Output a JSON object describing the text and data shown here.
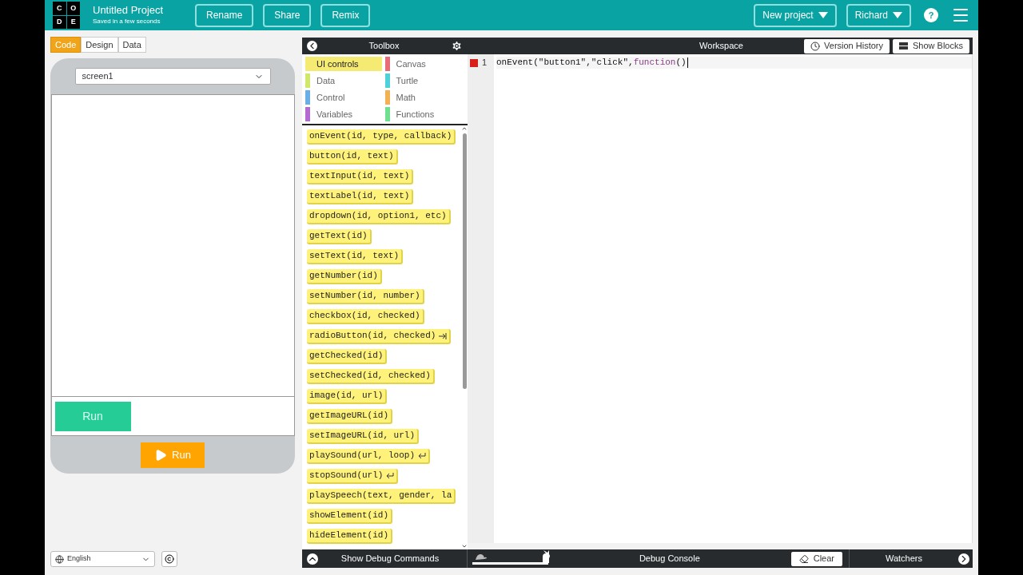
{
  "header": {
    "logo_letters": [
      "C",
      "O",
      "D",
      "E"
    ],
    "project_title": "Untitled Project",
    "save_status": "Saved in a few seconds",
    "buttons": [
      "Rename",
      "Share",
      "Remix"
    ],
    "new_project": "New project",
    "user": "Richard",
    "help": "?"
  },
  "mode_tabs": [
    {
      "label": "Code",
      "selected": true
    },
    {
      "label": "Design",
      "selected": false
    },
    {
      "label": "Data",
      "selected": false
    }
  ],
  "app_preview": {
    "screen_select": "screen1",
    "app_button": "Run"
  },
  "run_button": "Run",
  "language": "English",
  "toolbox": {
    "title": "Toolbox",
    "categories": [
      {
        "label": "UI controls",
        "color": "#f5ea72",
        "selected": true
      },
      {
        "label": "Canvas",
        "color": "#e86b78",
        "selected": false
      },
      {
        "label": "Data",
        "color": "#cfe86b",
        "selected": false
      },
      {
        "label": "Turtle",
        "color": "#4fd1d9",
        "selected": false
      },
      {
        "label": "Control",
        "color": "#6aaee8",
        "selected": false
      },
      {
        "label": "Math",
        "color": "#f2b152",
        "selected": false
      },
      {
        "label": "Variables",
        "color": "#b36ad1",
        "selected": false
      },
      {
        "label": "Functions",
        "color": "#6fe08f",
        "selected": false
      }
    ],
    "blocks": [
      {
        "text": "onEvent(id, type, callback)",
        "kind": "plain"
      },
      {
        "text": "button(id, text)",
        "kind": "plain"
      },
      {
        "text": "textInput(id, text)",
        "kind": "plain"
      },
      {
        "text": "textLabel(id, text)",
        "kind": "plain"
      },
      {
        "text": "dropdown(id, option1, etc)",
        "kind": "plain"
      },
      {
        "text": "getText(id)",
        "kind": "plain"
      },
      {
        "text": "setText(id, text)",
        "kind": "plain"
      },
      {
        "text": "getNumber(id)",
        "kind": "plain"
      },
      {
        "text": "setNumber(id, number)",
        "kind": "plain"
      },
      {
        "text": "checkbox(id, checked)",
        "kind": "plain"
      },
      {
        "text": "radioButton(id, checked)",
        "kind": "arrow"
      },
      {
        "text": "getChecked(id)",
        "kind": "plain"
      },
      {
        "text": "setChecked(id, checked)",
        "kind": "plain"
      },
      {
        "text": "image(id, url)",
        "kind": "plain"
      },
      {
        "text": "getImageURL(id)",
        "kind": "plain"
      },
      {
        "text": "setImageURL(id, url)",
        "kind": "plain"
      },
      {
        "text": "playSound(url, loop)",
        "kind": "return"
      },
      {
        "text": "stopSound(url)",
        "kind": "return"
      },
      {
        "text": "playSpeech(text, gender, la",
        "kind": "plain"
      },
      {
        "text": "showElement(id)",
        "kind": "plain"
      },
      {
        "text": "hideElement(id)",
        "kind": "plain"
      }
    ]
  },
  "workspace": {
    "title": "Workspace",
    "version_history": "Version History",
    "show_blocks": "Show Blocks",
    "lines": [
      {
        "number": "1",
        "breakpoint": true,
        "code": "onEvent(\"button1\",\"click\",",
        "keyword": "function",
        "rest": "()"
      }
    ]
  },
  "debug": {
    "show_commands": "Show Debug Commands",
    "console": "Debug Console",
    "clear": "Clear",
    "watchers": "Watchers",
    "speed": {
      "level": 1
    }
  }
}
